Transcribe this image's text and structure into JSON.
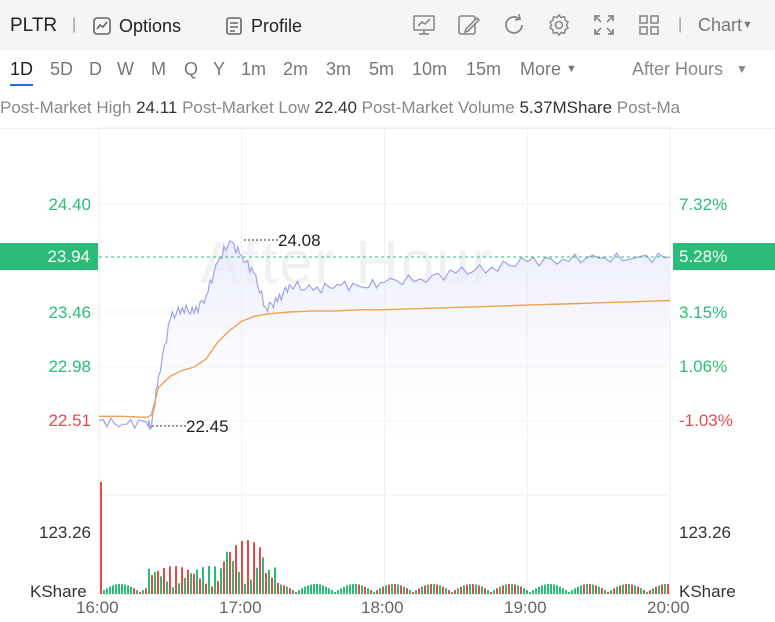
{
  "header": {
    "ticker": "PLTR",
    "options_label": "Options",
    "profile_label": "Profile",
    "chart_label": "Chart",
    "toolbar_icons": [
      "chart-compare-icon",
      "draw-pen-icon",
      "refresh-icon",
      "settings-icon",
      "fullscreen-icon",
      "layout-grid-icon"
    ]
  },
  "periods": {
    "items": [
      "1D",
      "5D",
      "D",
      "W",
      "M",
      "Q",
      "Y",
      "1m",
      "2m",
      "3m",
      "5m",
      "10m",
      "15m",
      "More"
    ],
    "active": "1D",
    "session": "After Hours"
  },
  "stats": [
    {
      "label": "Post-Market High",
      "value": "24.11"
    },
    {
      "label": "Post-Market Low",
      "value": "22.40"
    },
    {
      "label": "Post-Market Volume",
      "value": "5.37MShare"
    },
    {
      "label": "Post-Ma",
      "value": ""
    }
  ],
  "chart": {
    "watermark": "After Hour",
    "y_left": [
      "24.40",
      "23.94",
      "23.46",
      "22.98",
      "22.51"
    ],
    "y_right": [
      "7.32%",
      "5.28%",
      "3.15%",
      "1.06%",
      "-1.03%"
    ],
    "current_price": "23.94",
    "current_pct": "5.28%",
    "high_annotation": "24.08",
    "low_annotation": "22.45",
    "volume_label": "123.26",
    "volume_unit": "KShare",
    "x_labels": [
      "16:00",
      "17:00",
      "18:00",
      "19:00",
      "20:00"
    ],
    "colors": {
      "up": "#2bbd77",
      "down": "#e84848",
      "price_line": "#9ea3e6",
      "avg_line": "#f0a050",
      "accent": "#2a64f6"
    }
  },
  "chart_data": {
    "type": "line",
    "title": "",
    "xlabel": "",
    "ylabel": "",
    "x": [
      "16:00",
      "16:10",
      "16:20",
      "16:22",
      "16:25",
      "16:30",
      "16:35",
      "16:40",
      "16:45",
      "16:50",
      "16:55",
      "17:00",
      "17:05",
      "17:10",
      "17:15",
      "17:20",
      "17:30",
      "17:40",
      "17:50",
      "18:00",
      "18:15",
      "18:30",
      "18:45",
      "19:00",
      "19:15",
      "19:30",
      "19:45",
      "20:00"
    ],
    "series": [
      {
        "values": [
          22.51,
          22.48,
          22.5,
          22.45,
          22.9,
          23.4,
          23.5,
          23.45,
          23.6,
          23.9,
          24.08,
          23.95,
          23.8,
          23.5,
          23.55,
          23.7,
          23.65,
          23.7,
          23.68,
          23.72,
          23.75,
          23.8,
          23.85,
          23.9,
          23.92,
          23.93,
          23.93,
          23.94
        ]
      },
      {
        "values": [
          22.55,
          22.55,
          22.54,
          22.56,
          22.8,
          22.9,
          22.95,
          22.98,
          23.05,
          23.2,
          23.3,
          23.38,
          23.42,
          23.44,
          23.45,
          23.46,
          23.47,
          23.47,
          23.48,
          23.48,
          23.49,
          23.5,
          23.51,
          23.52,
          23.53,
          23.54,
          23.55,
          23.56
        ]
      }
    ],
    "ylim": [
      22.2,
      24.6
    ],
    "grid": true
  }
}
